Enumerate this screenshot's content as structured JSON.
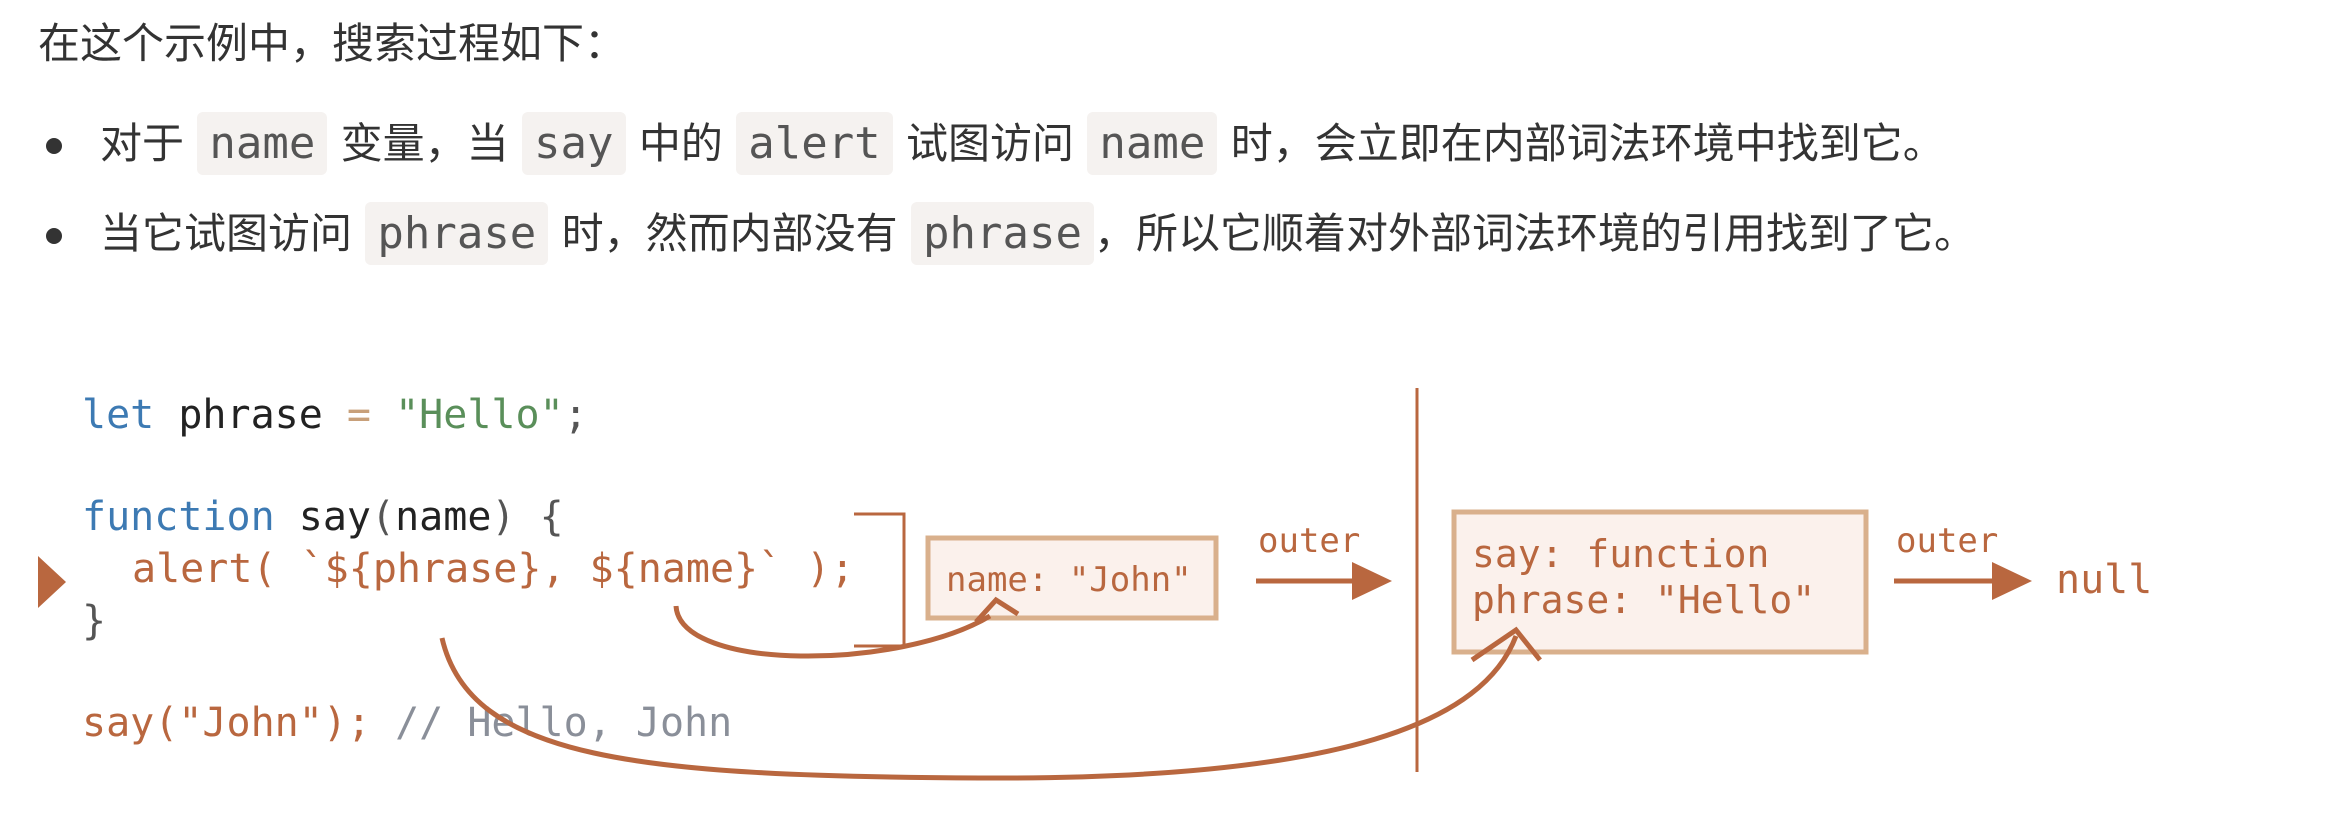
{
  "intro": "在这个示例中，搜索过程如下：",
  "bullets": [
    {
      "parts": [
        {
          "t": "text",
          "v": "对于 "
        },
        {
          "t": "code",
          "v": "name"
        },
        {
          "t": "text",
          "v": " 变量，当 "
        },
        {
          "t": "code",
          "v": "say"
        },
        {
          "t": "text",
          "v": " 中的 "
        },
        {
          "t": "code",
          "v": "alert"
        },
        {
          "t": "text",
          "v": " 试图访问 "
        },
        {
          "t": "code",
          "v": "name"
        },
        {
          "t": "text",
          "v": " 时，会立即在内部词法环境中找到它。"
        }
      ]
    },
    {
      "parts": [
        {
          "t": "text",
          "v": "当它试图访问 "
        },
        {
          "t": "code",
          "v": "phrase"
        },
        {
          "t": "text",
          "v": " 时，然而内部没有 "
        },
        {
          "t": "code",
          "v": "phrase"
        },
        {
          "t": "text",
          "v": "，所以它顺着对外部词法环境的引用找到了它。"
        }
      ]
    }
  ],
  "code": {
    "line1": {
      "kw": "let",
      "rest": " phrase ",
      "op": "=",
      "str": " \"Hello\"",
      "end": ";"
    },
    "line2": {
      "kw": "function",
      "name": " say",
      "p1": "(",
      "param": "name",
      "p2": ")",
      "brace": " {"
    },
    "line3": {
      "call": "alert( `${phrase}, ${name}` );"
    },
    "line4": "}",
    "line5": {
      "call": "say(\"John\");",
      "comment": " // Hello, John"
    }
  },
  "env_inner": "name: \"John\"",
  "env_outer_lines": [
    "say: function",
    "phrase: \"Hello\""
  ],
  "outer_label_1": "outer",
  "outer_label_2": "outer",
  "null_label": "null",
  "colors": {
    "accent": "#b9673f",
    "box_fill": "#fbf1ec",
    "box_stroke": "#d9b08c",
    "keyword": "#3d7ab3",
    "string": "#5a8f5a",
    "comment": "#8a8f99"
  }
}
